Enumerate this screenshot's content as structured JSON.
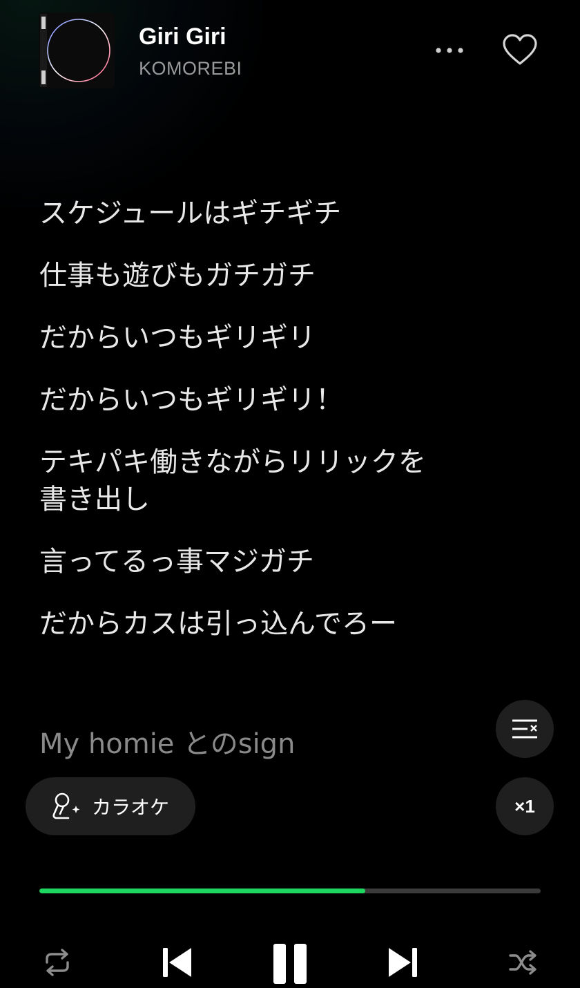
{
  "track": {
    "title": "Giri Giri",
    "artist": "KOMOREBI",
    "cover_icon": "album-cover-ring"
  },
  "header_actions": {
    "more_icon": "more-horizontal-icon",
    "like_icon": "heart-outline-icon"
  },
  "lyrics": {
    "lines": [
      "スケジュールはギチギチ",
      "仕事も遊びもガチガチ",
      "だからいつもギリギリ",
      "だからいつもギリギリ！",
      "テキパキ働きながらリリックを\n書き出し",
      "言ってるっ事マジガチ",
      "だからカスは引っ込んでろー"
    ],
    "upcoming": "My homie とのsign"
  },
  "karaoke": {
    "label": "カラオケ",
    "icon": "karaoke-mic-sparkle-icon"
  },
  "side_buttons": {
    "hide_lyrics_icon": "lyrics-close-icon",
    "speed_label": "×1"
  },
  "playback": {
    "progress": 0.65,
    "accent_color": "#1ed760",
    "track_color": "#3a3a3a"
  },
  "controls": {
    "repeat_icon": "repeat-icon",
    "previous_icon": "skip-previous-icon",
    "pause_icon": "pause-icon",
    "next_icon": "skip-next-icon",
    "shuffle_icon": "shuffle-icon"
  }
}
